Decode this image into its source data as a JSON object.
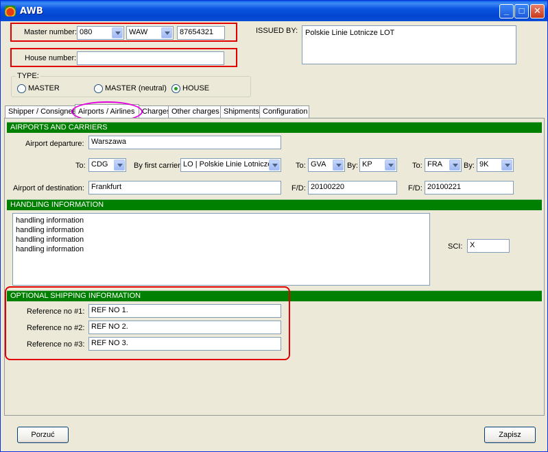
{
  "window": {
    "title": "AWB",
    "minimize": "_",
    "maximize": "□",
    "close": "✕",
    "icon": "app-icon"
  },
  "master": {
    "label": "Master number:",
    "prefix": "080",
    "airport": "WAW",
    "number": "87654321"
  },
  "house": {
    "label": "House number:",
    "value": ""
  },
  "issued_by": {
    "label": "ISSUED BY:",
    "value": "Polskie Linie Lotnicze LOT"
  },
  "type": {
    "label": "TYPE:",
    "options": [
      "MASTER",
      "MASTER (neutral)",
      "HOUSE"
    ],
    "selected": "HOUSE"
  },
  "tabs": [
    "Shipper / Consignee",
    "Airports / Airlines",
    "Charges",
    "Other charges",
    "Shipments",
    "Configuration"
  ],
  "active_tab": "Airports / Airlines",
  "airports": {
    "section": "AIRPORTS AND CARRIERS",
    "departure_label": "Airport departure:",
    "departure": "Warszawa",
    "to_label": "To:",
    "to1": "CDG",
    "by_first_label": "By first carrier:",
    "first_carrier": "LO | Polskie Linie Lotnicze",
    "to2": "GVA",
    "by_label": "By:",
    "by2": "KP",
    "to3": "FRA",
    "by3": "9K",
    "destination_label": "Airport of destination:",
    "destination": "Frankfurt",
    "fd_label": "F/D:",
    "fd1": "20100220",
    "fd2": "20100221"
  },
  "handling": {
    "section": "HANDLING INFORMATION",
    "lines": [
      "handling information",
      "handling information",
      "handling information",
      "handling information"
    ],
    "sci_label": "SCI:",
    "sci": "X"
  },
  "optional": {
    "section": "OPTIONAL SHIPPING INFORMATION",
    "ref1_label": "Reference no #1:",
    "ref1": "REF NO 1.",
    "ref2_label": "Reference no #2:",
    "ref2": "REF NO 2.",
    "ref3_label": "Reference no #3:",
    "ref3": "REF NO 3."
  },
  "buttons": {
    "discard": "Porzuć",
    "save": "Zapisz"
  },
  "colors": {
    "section_green": "#008000",
    "highlight_red": "#e00000",
    "highlight_magenta": "#e000e0",
    "titlebar_blue": "#0a54e0"
  }
}
